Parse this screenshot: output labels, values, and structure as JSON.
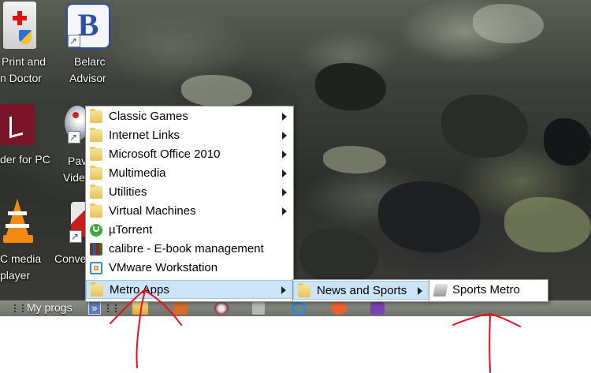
{
  "desktop": {
    "icons": [
      {
        "name": "print-and-fax-doctor",
        "line1": "Print and",
        "line2": "n Doctor"
      },
      {
        "name": "belarc-advisor",
        "line1": "Belarc",
        "line2": "Advisor"
      },
      {
        "name": "reader-for-pc",
        "line1": "der for PC",
        "line2": ""
      },
      {
        "name": "pavtube-video",
        "line1": "Pav",
        "line2": "Vide"
      },
      {
        "name": "vlc-media-player",
        "line1": "C media",
        "line2": "player"
      },
      {
        "name": "converter",
        "line1": "Conve",
        "line2": ""
      }
    ]
  },
  "taskbar": {
    "toolbar_label": "My progs",
    "chevron": "»"
  },
  "menu": {
    "items": [
      {
        "label": "Classic Games",
        "icon": "folder-icon",
        "submenu": true
      },
      {
        "label": "Internet Links",
        "icon": "folder-icon",
        "submenu": true
      },
      {
        "label": "Microsoft Office 2010",
        "icon": "folder-icon",
        "submenu": true
      },
      {
        "label": "Multimedia",
        "icon": "folder-icon",
        "submenu": true
      },
      {
        "label": "Utilities",
        "icon": "folder-icon",
        "submenu": true
      },
      {
        "label": "Virtual Machines",
        "icon": "folder-icon",
        "submenu": true
      },
      {
        "label": "µTorrent",
        "icon": "utorrent-icon",
        "submenu": false
      },
      {
        "label": "calibre - E-book management",
        "icon": "calibre-icon",
        "submenu": false
      },
      {
        "label": "VMware Workstation",
        "icon": "vmware-icon",
        "submenu": false
      },
      {
        "label": "Metro Apps",
        "icon": "folder-icon",
        "submenu": true
      }
    ],
    "submenu1": {
      "label": "News and Sports",
      "icon": "folder-icon"
    },
    "submenu2": {
      "label": "Sports Metro",
      "icon": "sports-metro-icon"
    }
  },
  "colors": {
    "highlight": "#cce4f7",
    "annotation": "#e8101c"
  }
}
